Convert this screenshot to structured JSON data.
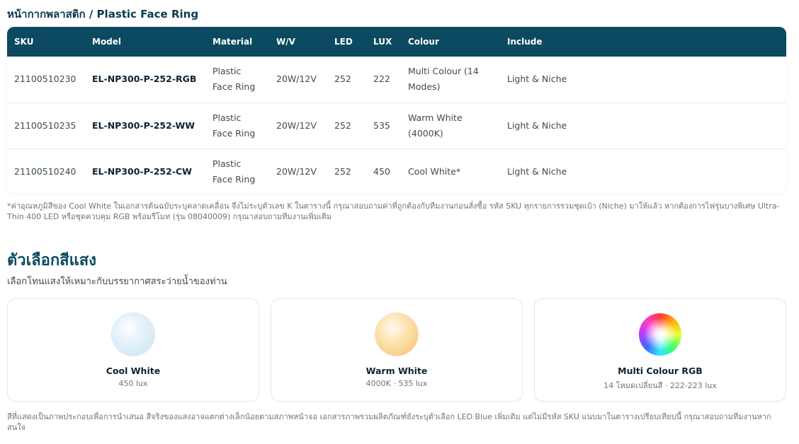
{
  "section": {
    "title": "หน้ากากพลาสติก / Plastic Face Ring"
  },
  "table": {
    "headers": [
      "SKU",
      "Model",
      "Material",
      "W/V",
      "LED",
      "LUX",
      "Colour",
      "Include"
    ],
    "rows": [
      {
        "sku": "21100510230",
        "model": "EL-NP300-P-252-RGB",
        "material": "Plastic Face Ring",
        "wv": "20W/12V",
        "led": "252",
        "lux": "222",
        "colour": "Multi Colour (14 Modes)",
        "include": "Light & Niche"
      },
      {
        "sku": "21100510235",
        "model": "EL-NP300-P-252-WW",
        "material": "Plastic Face Ring",
        "wv": "20W/12V",
        "led": "252",
        "lux": "535",
        "colour": "Warm White (4000K)",
        "include": "Light & Niche"
      },
      {
        "sku": "21100510240",
        "model": "EL-NP300-P-252-CW",
        "material": "Plastic Face Ring",
        "wv": "20W/12V",
        "led": "252",
        "lux": "450",
        "colour": "Cool White*",
        "include": "Light & Niche"
      }
    ]
  },
  "note": "*ค่าอุณหภูมิสีของ Cool White ในเอกสารต้นฉบับระบุคลาดเคลื่อน จึงไม่ระบุตัวเลข K ในตารางนี้ กรุณาสอบถามค่าที่ถูกต้องกับทีมงานก่อนสั่งซื้อ รหัส SKU ทุกรายการรวมชุดเบ้า (Niche) มาให้แล้ว หากต้องการไฟรุ่นบางพิเศษ Ultra-Thin 400 LED หรือชุดควบคุม RGB พร้อมรีโมท (รุ่น 08040009) กรุณาสอบถามทีมงานเพิ่มเติม",
  "colours": {
    "heading": "ตัวเลือกสีแสง",
    "subheading": "เลือกโทนแสงให้เหมาะกับบรรยากาศสระว่ายน้ำของท่าน",
    "cards": [
      {
        "name": "Cool White",
        "meta": "450 lux",
        "swatch": "cool-white"
      },
      {
        "name": "Warm White",
        "meta": "4000K · 535 lux",
        "swatch": "warm-white"
      },
      {
        "name": "Multi Colour RGB",
        "meta": "14 โหมดเปลี่ยนสี · 222-223 lux",
        "swatch": "multi-colour"
      }
    ]
  },
  "footer": "สีที่แสดงเป็นภาพประกอบเพื่อการนำเสนอ สีจริงของแสงอาจแตกต่างเล็กน้อยตามสภาพหน้าจอ เอกสารภาพรวมผลิตภัณฑ์ยังระบุตัวเลือก LED Blue เพิ่มเติม แต่ไม่มีรหัส SKU แนบมาในตารางเปรียบเทียบนี้ กรุณาสอบถามทีมงานหากสนใจ",
  "theme": {
    "header_bg": "#0b4a60",
    "accent": "#0b4a60"
  }
}
